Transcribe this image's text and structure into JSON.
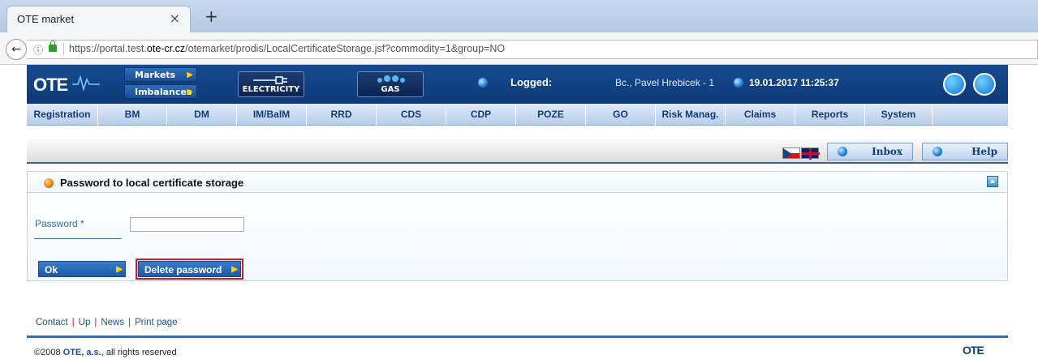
{
  "browser": {
    "tab_title": "OTE market",
    "tab_close": "×",
    "new_tab": "+",
    "url_prefix": "https://portal.test.",
    "url_domain": "ote-cr.cz",
    "url_path": "/otemarket/prodis/LocalCertificateStorage.jsf?commodity=1&group=NO"
  },
  "header": {
    "logo": "OTE",
    "markets_label": "Markets",
    "imbalances_label": "Imbalances",
    "electricity_label": "ELECTRICITY",
    "gas_label": "GAS",
    "logged_label": "Logged:",
    "user": "Bc., Pavel Hrebicek - 1",
    "datetime": "19.01.2017 11:25:37"
  },
  "nav": {
    "items": [
      "Registration",
      "BM",
      "DM",
      "IM/BalM",
      "RRD",
      "CDS",
      "CDP",
      "POZE",
      "GO",
      "Risk Manag.",
      "Claims",
      "Reports",
      "System"
    ]
  },
  "toolbar": {
    "inbox_label": "Inbox",
    "help_label": "Help"
  },
  "panel": {
    "title": "Password to local certificate storage",
    "password_label": "Password *",
    "password_value": "",
    "ok_label": "Ok",
    "delete_label": "Delete password"
  },
  "footer": {
    "contact": "Contact",
    "up": "Up",
    "news": "News",
    "print": "Print page",
    "copyright_prefix": "©2008 ",
    "copyright_company": "OTE, a.s.",
    "copyright_suffix": ", all rights reserved",
    "logo": "OTE"
  },
  "colors": {
    "header_blue": "#0d3a78",
    "nav_text": "#123d78",
    "highlight_red": "#e0141e",
    "accent_yellow": "#ffd400"
  }
}
